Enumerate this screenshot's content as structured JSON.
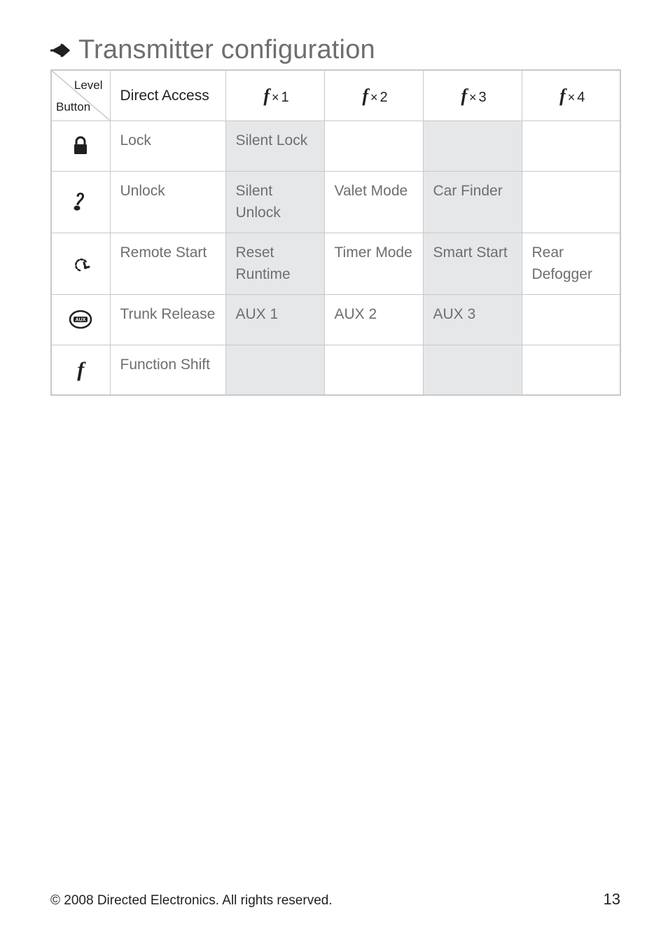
{
  "heading": "Transmitter configuration",
  "header": {
    "diag_top": "Level",
    "diag_bottom": "Button",
    "direct": "Direct Access",
    "f1_num": "1",
    "f2_num": "2",
    "f3_num": "3",
    "f4_num": "4"
  },
  "rows": [
    {
      "icon": "lock-icon",
      "direct": "Lock",
      "f1": "Silent Lock",
      "f2": "",
      "f3": "",
      "f4": ""
    },
    {
      "icon": "unlock-icon",
      "direct": "Unlock",
      "f1": "Silent Unlock",
      "f2": "Valet Mode",
      "f3": "Car Finder",
      "f4": ""
    },
    {
      "icon": "remote-start-icon",
      "direct": "Remote Start",
      "f1": "Reset Runtime",
      "f2": "Timer Mode",
      "f3": "Smart Start",
      "f4": "Rear Defogger"
    },
    {
      "icon": "aux-icon",
      "direct": "Trunk Release",
      "f1": "AUX 1",
      "f2": "AUX 2",
      "f3": "AUX 3",
      "f4": ""
    },
    {
      "icon": "function-icon",
      "direct": "Function Shift",
      "f1": "",
      "f2": "",
      "f3": "",
      "f4": ""
    }
  ],
  "footer": {
    "copyright": "© 2008 Directed Electronics. All rights reserved.",
    "page_number": "13"
  }
}
